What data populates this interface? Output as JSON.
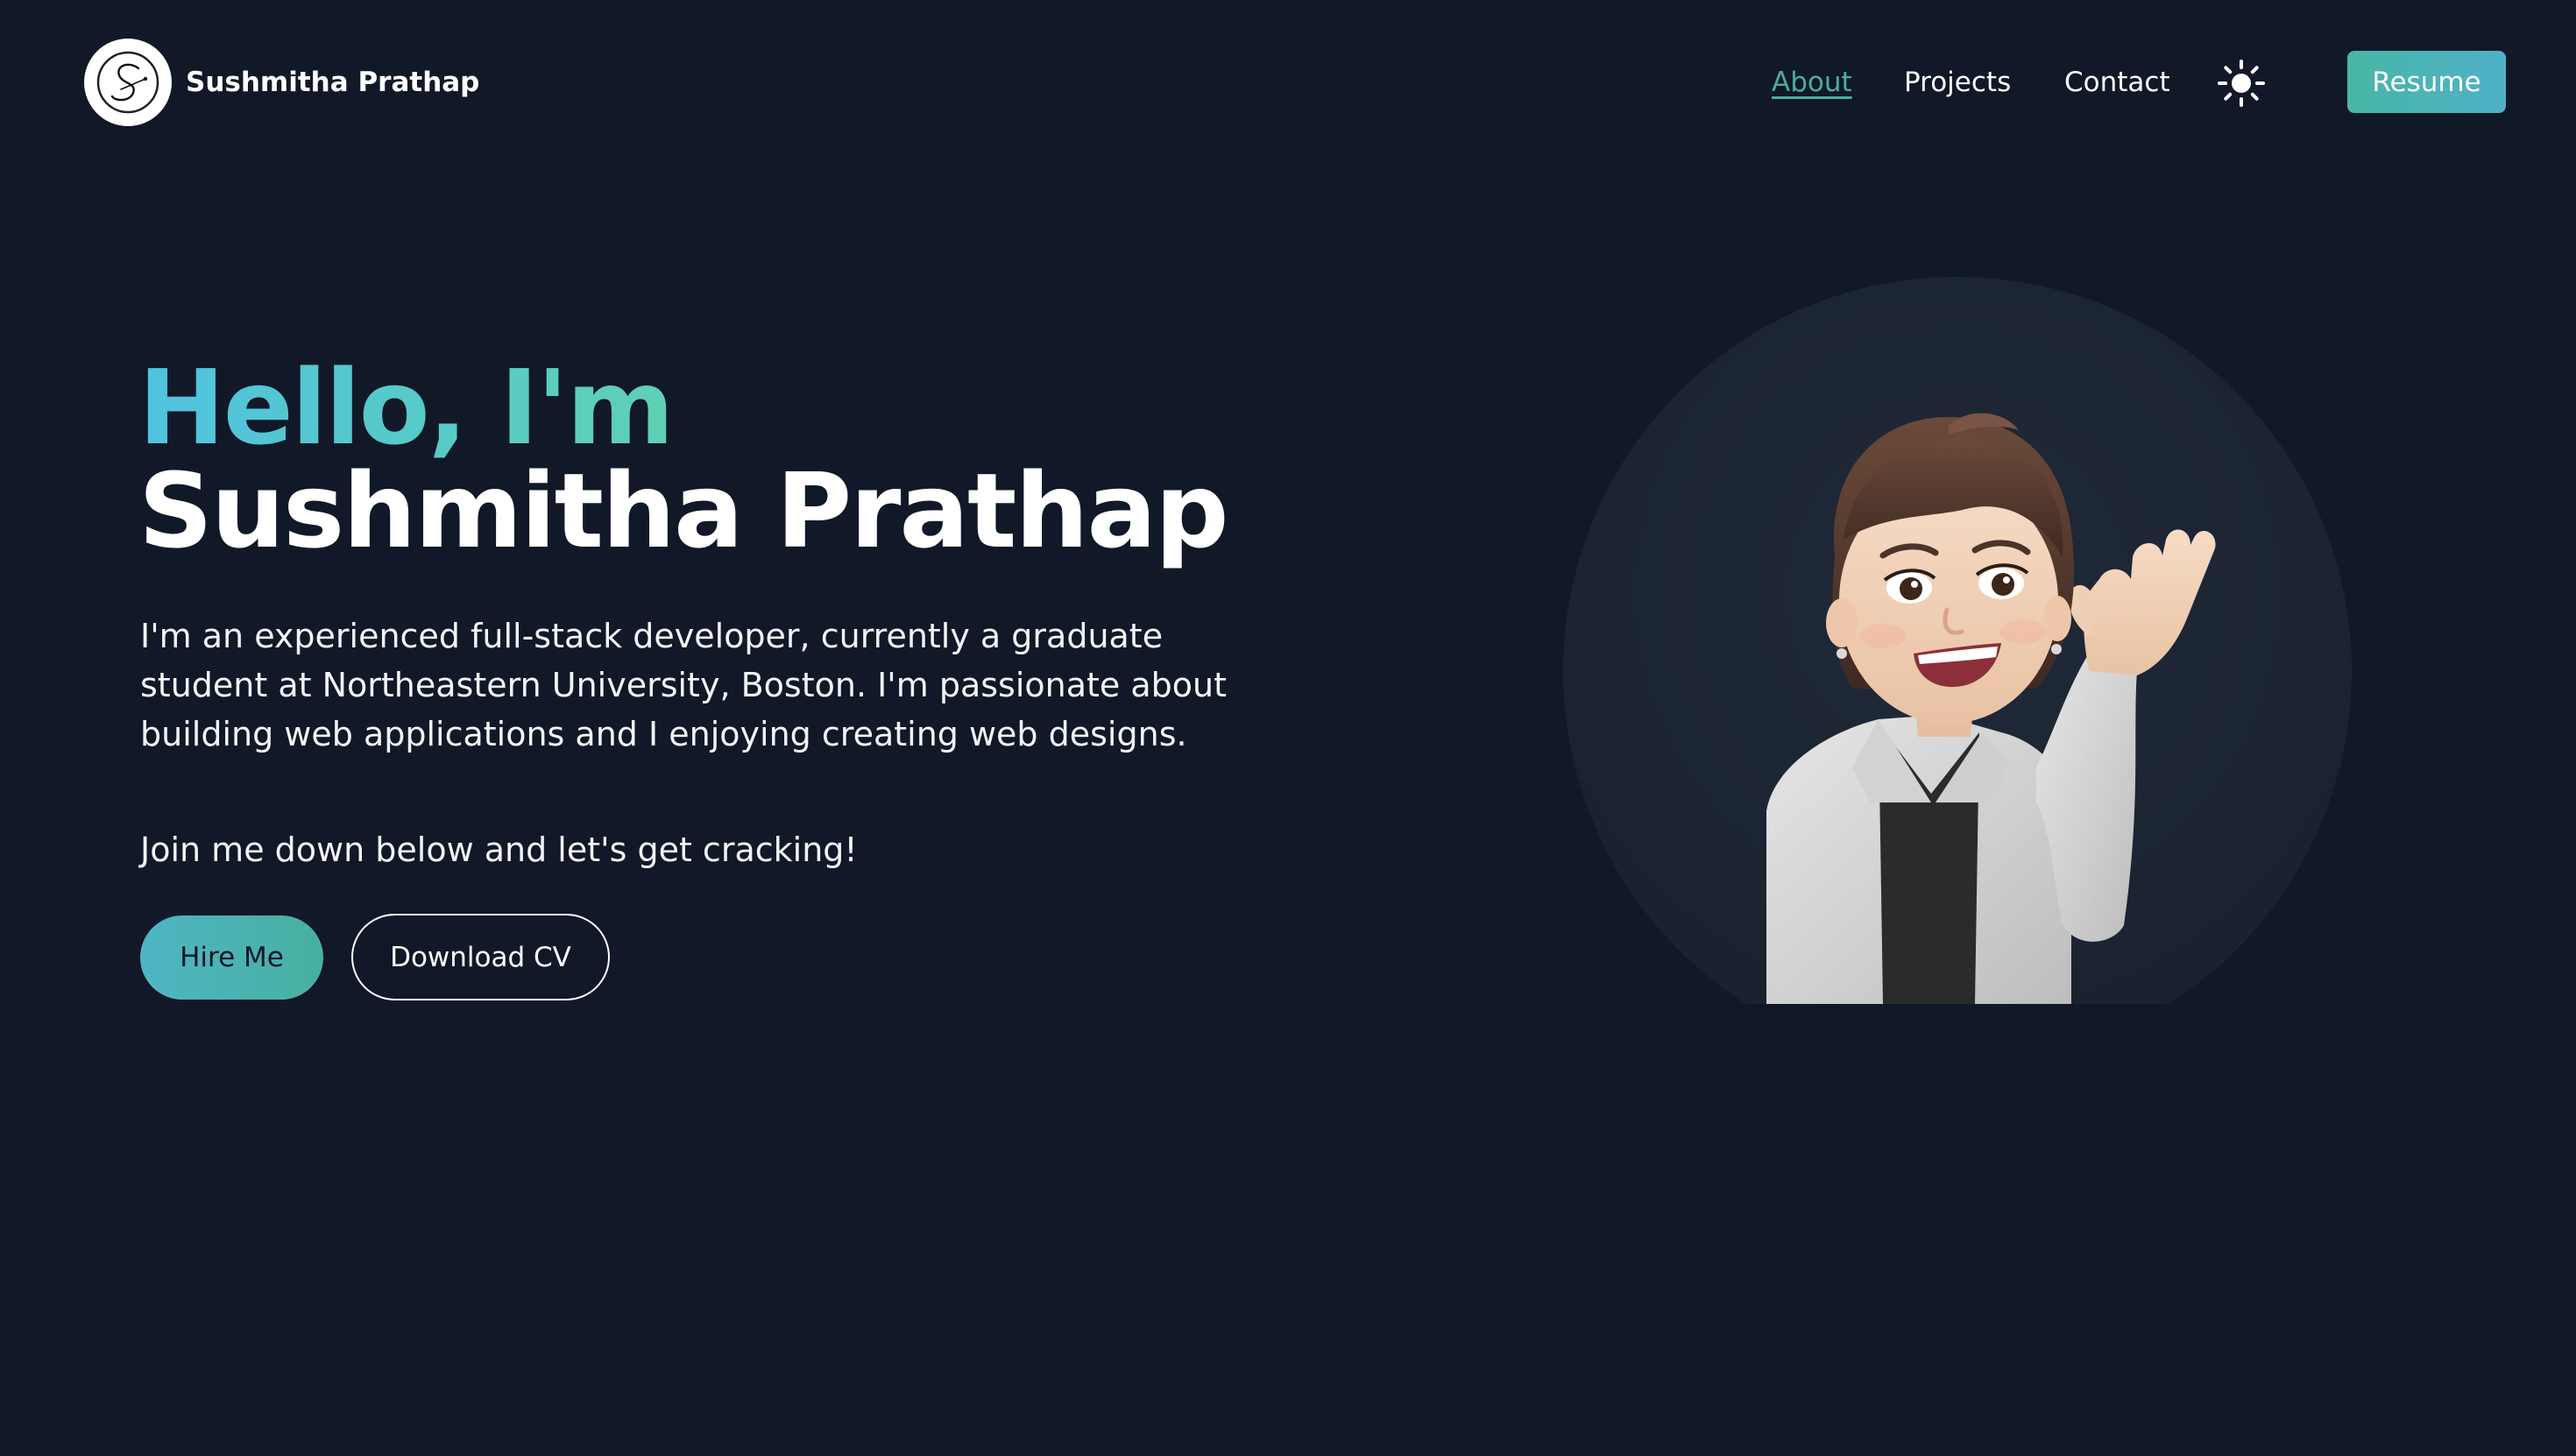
{
  "header": {
    "brand_name": "Sushmitha Prathap",
    "logo_icon": "signature-s-logo",
    "nav": [
      {
        "label": "About",
        "active": true
      },
      {
        "label": "Projects",
        "active": false
      },
      {
        "label": "Contact",
        "active": false
      }
    ],
    "theme_icon": "sun-icon",
    "resume_label": "Resume"
  },
  "hero": {
    "greeting": "Hello, I'm",
    "name": "Sushmitha Prathap",
    "description": "I'm an experienced full-stack developer, currently a graduate student at Northeastern University, Boston. I'm passionate about building web applications and I enjoying creating web designs.",
    "cta_text": "Join me down below and let's get cracking!",
    "hire_label": "Hire Me",
    "cv_label": "Download CV"
  },
  "avatar": {
    "icon": "waving-memoji-avatar"
  },
  "colors": {
    "background": "#111827",
    "accent_teal": "#4dab9e",
    "accent_cyan": "#4fc3e0",
    "avatar_bg": "#1f2937"
  }
}
